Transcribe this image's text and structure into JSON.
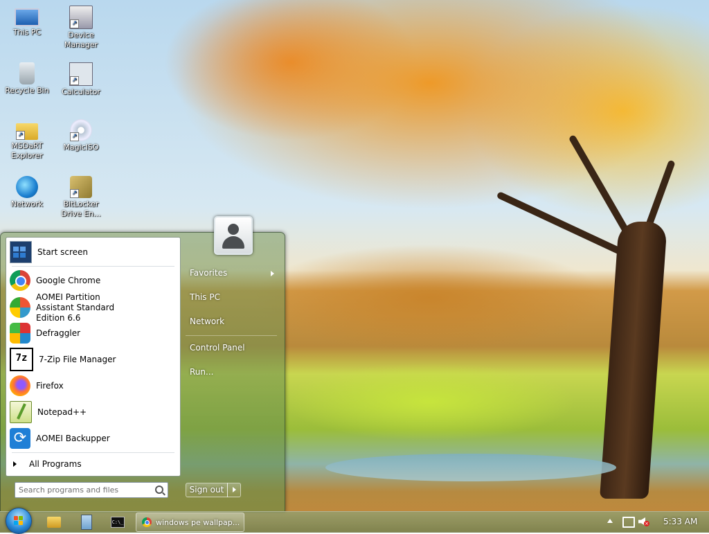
{
  "desktop": {
    "icons": [
      {
        "label": "This PC",
        "icon": "computer-icon"
      },
      {
        "label": "Device Manager",
        "icon": "device-manager-icon"
      },
      {
        "label": "Recycle Bin",
        "icon": "recycle-bin-icon"
      },
      {
        "label": "Calculator",
        "icon": "calculator-icon"
      },
      {
        "label": "MSDaRT Explorer",
        "icon": "folder-icon"
      },
      {
        "label": "MagicISO",
        "icon": "disc-icon"
      },
      {
        "label": "Network",
        "icon": "network-globe-icon"
      },
      {
        "label": "BitLocker Drive En...",
        "icon": "bitlocker-keys-icon"
      }
    ]
  },
  "start_menu": {
    "programs": [
      {
        "label": "Start screen",
        "icon": "start-screen-icon"
      },
      {
        "label": "Google Chrome",
        "icon": "chrome-icon"
      },
      {
        "label": "AOMEI Partition Assistant Standard Edition 6.6",
        "icon": "aomei-partition-icon"
      },
      {
        "label": "Defraggler",
        "icon": "defraggler-icon"
      },
      {
        "label": "7-Zip File Manager",
        "icon": "7zip-icon"
      },
      {
        "label": "Firefox",
        "icon": "firefox-icon"
      },
      {
        "label": "Notepad++",
        "icon": "notepadpp-icon"
      },
      {
        "label": "AOMEI Backupper",
        "icon": "aomei-backupper-icon"
      }
    ],
    "all_programs_label": "All Programs",
    "search_placeholder": "Search programs and files",
    "right_links": {
      "favorites": "Favorites",
      "this_pc": "This PC",
      "network": "Network",
      "control_panel": "Control Panel",
      "run": "Run..."
    },
    "sign_out_label": "Sign out"
  },
  "taskbar": {
    "pinned": [
      "file-explorer-icon",
      "notepad-icon",
      "command-prompt-icon"
    ],
    "cmd_glyph": "C:\\_",
    "active_window_label": "windows pe wallpap...",
    "clock": "5:33 AM",
    "tray_icons": [
      "show-hidden-icons-arrow",
      "network-icon",
      "volume-muted-icon"
    ]
  }
}
